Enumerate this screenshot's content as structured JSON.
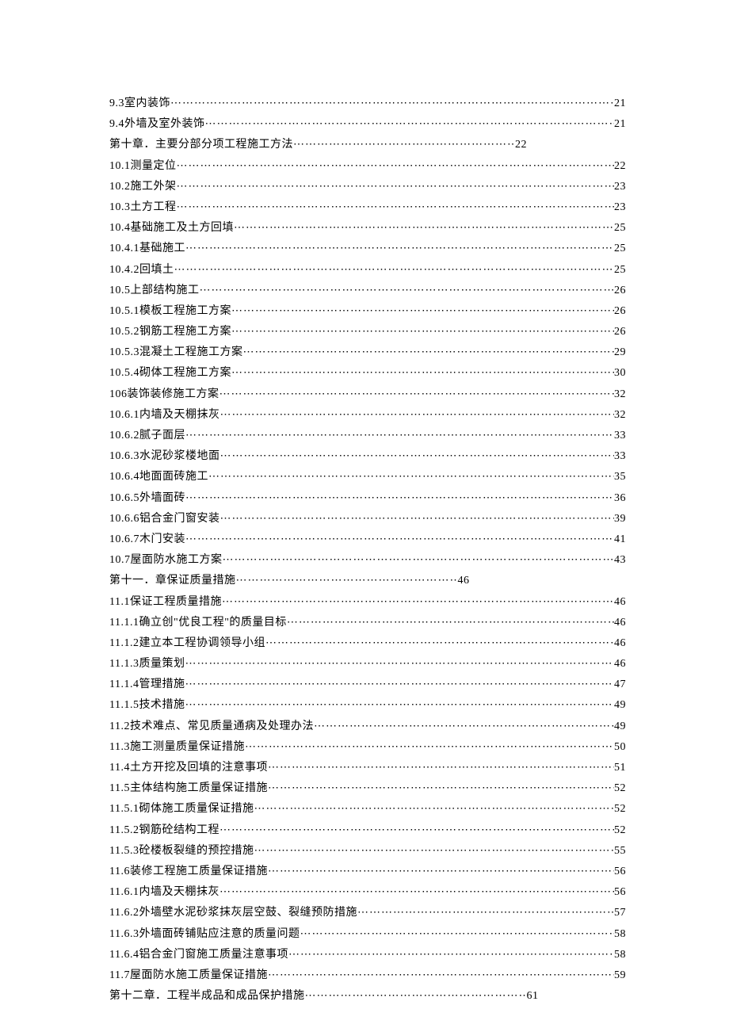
{
  "toc": [
    {
      "title": "9.3室内装饰",
      "page": "21",
      "short": false
    },
    {
      "title": "9.4外墙及室外装饰",
      "page": "21",
      "short": false
    },
    {
      "title": "第十章．主要分部分项工程施工方法",
      "page": "22",
      "short": true
    },
    {
      "title": "10.1测量定位",
      "page": "22",
      "short": false
    },
    {
      "title": "10.2施工外架",
      "page": "23",
      "short": false
    },
    {
      "title": "10.3土方工程",
      "page": "23",
      "short": false
    },
    {
      "title": "10.4基础施工及土方回填",
      "page": "25",
      "short": false
    },
    {
      "title": "10.4.1基础施工",
      "page": "25",
      "short": false
    },
    {
      "title": "10.4.2回填土",
      "page": "25",
      "short": false
    },
    {
      "title": "10.5上部结构施工",
      "page": "26",
      "short": false
    },
    {
      "title": "10.5.1模板工程施工方案",
      "page": "26",
      "short": false
    },
    {
      "title": "10.5.2钢筋工程施工方案",
      "page": "26",
      "short": false
    },
    {
      "title": "10.5.3混凝土工程施工方案",
      "page": "29",
      "short": false
    },
    {
      "title": "10.5.4砌体工程施工方案",
      "page": "30",
      "short": false
    },
    {
      "title": "106装饰装修施工方案",
      "page": "32",
      "short": false
    },
    {
      "title": "10.6.1内墙及天棚抹灰",
      "page": "32",
      "short": false
    },
    {
      "title": "10.6.2腻子面层",
      "page": "33",
      "short": false
    },
    {
      "title": "10.6.3水泥砂浆楼地面",
      "page": "33",
      "short": false
    },
    {
      "title": "10.6.4地面面砖施工",
      "page": "35",
      "short": false
    },
    {
      "title": "10.6.5外墙面砖",
      "page": "36",
      "short": false
    },
    {
      "title": "10.6.6铝合金门窗安装",
      "page": "39",
      "short": false
    },
    {
      "title": "10.6.7木门安装",
      "page": "41",
      "short": false
    },
    {
      "title": "10.7屋面防水施工方案",
      "page": "43",
      "short": false
    },
    {
      "title": "第十一．章保证质量措施",
      "page": "46",
      "short": true
    },
    {
      "title": "11.1保证工程质量措施",
      "page": "46",
      "short": false
    },
    {
      "title": "11.1.1确立创\"优良工程\"的质量目标",
      "page": "46",
      "short": false
    },
    {
      "title": "11.1.2建立本工程协调领导小组",
      "page": "46",
      "short": false
    },
    {
      "title": "11.1.3质量策划",
      "page": "46",
      "short": false
    },
    {
      "title": "11.1.4管理措施",
      "page": "47",
      "short": false
    },
    {
      "title": "11.1.5技术措施",
      "page": "49",
      "short": false
    },
    {
      "title": "11.2技术难点、常见质量通病及处理办法",
      "page": "49",
      "short": false
    },
    {
      "title": "11.3施工测量质量保证措施",
      "page": "50",
      "short": false
    },
    {
      "title": "11.4土方开挖及回填的注意事项",
      "page": "51",
      "short": false
    },
    {
      "title": "11.5主体结构施工质量保证措施",
      "page": "52",
      "short": false
    },
    {
      "title": "11.5.1砌体施工质量保证措施",
      "page": "52",
      "short": false
    },
    {
      "title": "11.5.2钢筋砼结构工程",
      "page": "52",
      "short": false
    },
    {
      "title": "11.5.3砼楼板裂缝的预控措施",
      "page": "55",
      "short": false
    },
    {
      "title": "11.6装修工程施工质量保证措施",
      "page": "56",
      "short": false
    },
    {
      "title": "11.6.1内墙及天棚抹灰",
      "page": "56",
      "short": false
    },
    {
      "title": "11.6.2外墙壁水泥砂浆抹灰层空鼓、裂缝预防措施",
      "page": "57",
      "short": false
    },
    {
      "title": "11.6.3外墙面砖铺贴应注意的质量问题",
      "page": "58",
      "short": false
    },
    {
      "title": "11.6.4铝合金门窗施工质量注意事项",
      "page": "58",
      "short": false
    },
    {
      "title": "11.7屋面防水施工质量保证措施",
      "page": "59",
      "short": false
    },
    {
      "title": "第十二章．工程半成品和成品保护措施",
      "page": "61",
      "short": true
    }
  ],
  "dotsLong": "⋯⋯⋯⋯⋯⋯⋯⋯⋯⋯⋯⋯⋯⋯⋯⋯⋯⋯⋯⋯⋯⋯⋯⋯⋯⋯⋯⋯⋯⋯⋯⋯⋯⋯⋯⋯⋯⋯⋯⋯⋯⋯⋯⋯⋯⋯⋯⋯⋯⋯⋯⋯⋯⋯⋯⋯⋯⋯⋯⋯⋯⋯⋯⋯⋯⋯⋯⋯⋯⋯⋯⋯⋯⋯⋯⋯⋯⋯⋯⋯⋯⋯⋯⋯⋯⋯⋯⋯⋯⋯⋯⋯⋯⋯⋯⋯⋯⋯⋯⋯⋯⋯⋯⋯⋯⋯⋯⋯⋯⋯⋯⋯⋯⋯⋯⋯⋯⋯⋯⋯",
  "dotsShort": "⋯⋯⋯⋯⋯⋯⋯⋯⋯⋯⋯⋯⋯⋯⋯⋯⋯⋯⋯⋯⋯⋯⋯⋯⋯⋯⋯⋯⋯⋯⋯⋯"
}
